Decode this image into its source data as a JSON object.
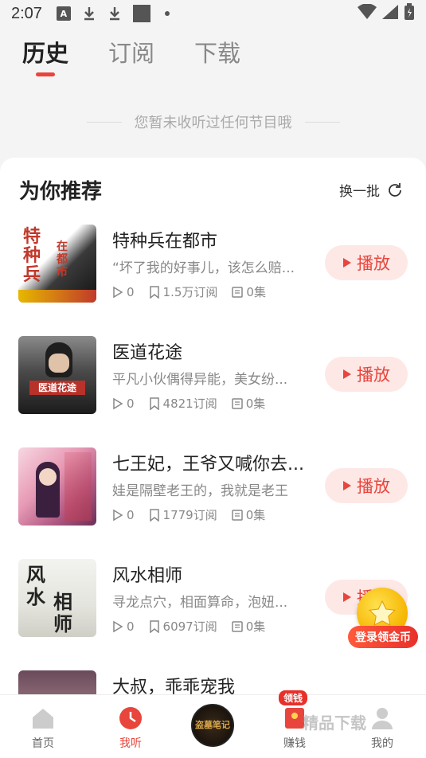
{
  "status_bar": {
    "time": "2:07",
    "a_badge": "A"
  },
  "tabs": [
    {
      "label": "历史",
      "active": true
    },
    {
      "label": "订阅",
      "active": false
    },
    {
      "label": "下载",
      "active": false
    }
  ],
  "empty_notice": "您暂未收听过任何节目哦",
  "recommend": {
    "title": "为你推荐",
    "refresh_label": "换一批",
    "play_label": "播放",
    "items": [
      {
        "title": "特种兵在都市",
        "desc": "“坏了我的好事儿，该怎么赔...",
        "plays": "0",
        "subs": "1.5万订阅",
        "episodes": "0集",
        "cover_text": "特种兵在都市"
      },
      {
        "title": "医道花途",
        "desc": "平凡小伙偶得异能，美女纷...",
        "plays": "0",
        "subs": "4821订阅",
        "episodes": "0集",
        "cover_text": "医道花途"
      },
      {
        "title": "七王妃，王爷又喊你去...",
        "desc": "娃是隔壁老王的，我就是老王",
        "plays": "0",
        "subs": "1779订阅",
        "episodes": "0集",
        "cover_text": ""
      },
      {
        "title": "风水相师",
        "desc": "寻龙点穴，相面算命，泡妞...",
        "plays": "0",
        "subs": "6097订阅",
        "episodes": "0集",
        "cover_text": "风水相师"
      },
      {
        "title": "大叔，乖乖宠我",
        "desc": "",
        "plays": "",
        "subs": "",
        "episodes": "",
        "cover_text": ""
      }
    ]
  },
  "coin_widget": {
    "label": "登录领金币"
  },
  "bottom_nav": {
    "home": "首页",
    "listen": "我听",
    "center_text": "盗墓笔记",
    "earn": "赚钱",
    "earn_badge": "领钱",
    "mine": "我的"
  },
  "watermark": "精品下载",
  "colors": {
    "accent": "#e8453c",
    "accent_light": "#fde8e6",
    "coin": "#f5b400"
  }
}
